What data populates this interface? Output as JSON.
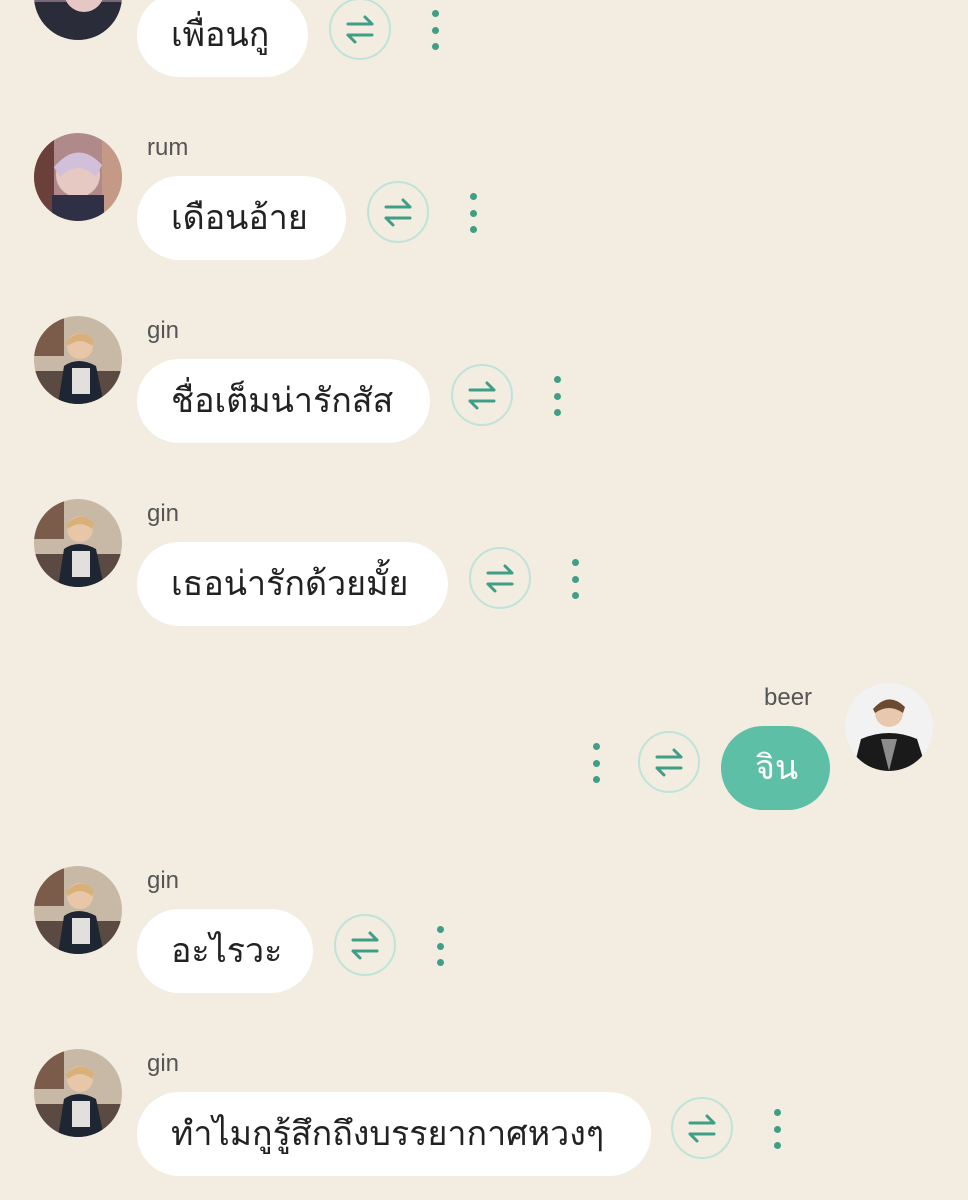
{
  "colors": {
    "background": "#f2ece1",
    "bubble_other": "#ffffff",
    "bubble_self": "#5dbfa6",
    "accent": "#3f9e86",
    "translate_border": "#bfe3d9"
  },
  "messages": [
    {
      "sender": "",
      "text": "เพื่อนกู",
      "avatar": "avatar-gin-pink"
    },
    {
      "sender": "rum",
      "text": "เดือนอ้าย",
      "avatar": "avatar-rum"
    },
    {
      "sender": "gin",
      "text": "ชื่อเต็มน่ารักสัส",
      "avatar": "avatar-gin"
    },
    {
      "sender": "gin",
      "text": "เธอน่ารักด้วยมั้ย",
      "avatar": "avatar-gin"
    },
    {
      "sender": "beer",
      "text": "จิน",
      "avatar": "avatar-beer",
      "self": true
    },
    {
      "sender": "gin",
      "text": "อะไรวะ",
      "avatar": "avatar-gin"
    },
    {
      "sender": "gin",
      "text": "ทำไมกูรู้สึกถึงบรรยากาศหวงๆ",
      "avatar": "avatar-gin"
    }
  ],
  "icons": {
    "translate": "translate-arrows-icon",
    "more": "more-vertical-icon"
  }
}
